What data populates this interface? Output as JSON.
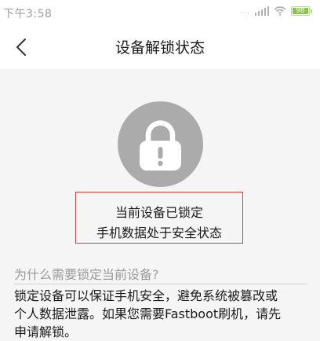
{
  "status_bar": {
    "time": "下午3:58",
    "dots": "...",
    "battery_level": "98"
  },
  "header": {
    "title": "设备解锁状态"
  },
  "lock": {
    "status_line1": "当前设备已锁定",
    "status_line2": "手机数据处于安全状态"
  },
  "info": {
    "heading": "为什么需要锁定当前设备?",
    "body_line1": "锁定设备可以保证手机安全，避免系统被篡改或",
    "body_line2": "个人数据泄露。如果您需要Fastboot刷机，请先",
    "body_line3": "申请解锁。"
  },
  "colors": {
    "lock_circle": "#ababab",
    "highlight_border": "#d93a3a",
    "battery": "#8bc34a"
  },
  "icons": [
    "back-arrow-icon",
    "padlock-icon",
    "signal-icon",
    "wifi-icon",
    "battery-icon"
  ]
}
